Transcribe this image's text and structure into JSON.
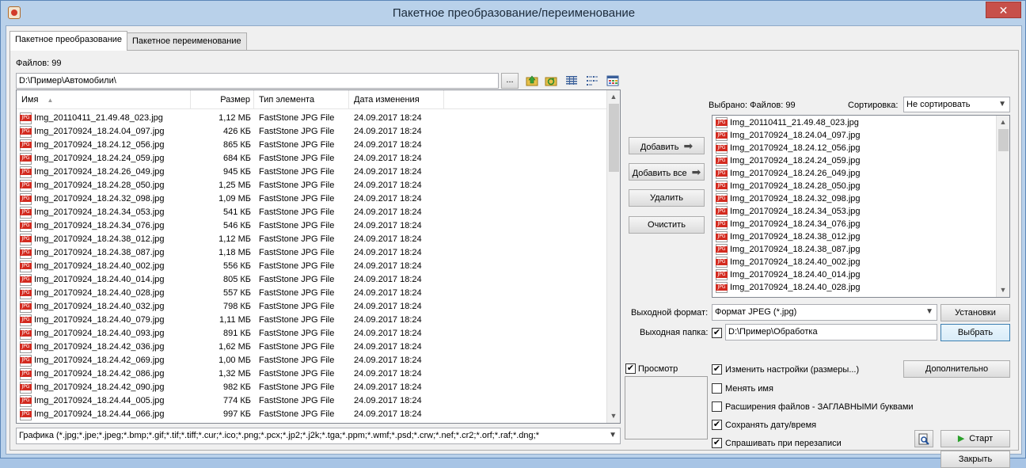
{
  "window": {
    "title": "Пакетное преобразование/переименование",
    "close_glyph": "✕"
  },
  "tabs": [
    {
      "label": "Пакетное преобразование",
      "active": true
    },
    {
      "label": "Пакетное переименование",
      "active": false
    }
  ],
  "source": {
    "files_count_label": "Файлов: 99",
    "path_value": "D:\\Пример\\Автомобили\\",
    "browse_label": "...",
    "toolbar_icons": [
      "folder-up-icon",
      "refresh-folder-icon",
      "details-view-icon",
      "list-view-icon",
      "thumbnails-view-icon"
    ]
  },
  "file_list": {
    "columns": {
      "name": "Имя",
      "size": "Размер",
      "type": "Тип элемента",
      "date": "Дата изменения"
    },
    "sort_glyph": "▲",
    "rows": [
      {
        "name": "Img_20110411_21.49.48_023.jpg",
        "size": "1,12 МБ",
        "type": "FastStone JPG File",
        "date": "24.09.2017 18:24"
      },
      {
        "name": "Img_20170924_18.24.04_097.jpg",
        "size": "426 КБ",
        "type": "FastStone JPG File",
        "date": "24.09.2017 18:24"
      },
      {
        "name": "Img_20170924_18.24.12_056.jpg",
        "size": "865 КБ",
        "type": "FastStone JPG File",
        "date": "24.09.2017 18:24"
      },
      {
        "name": "Img_20170924_18.24.24_059.jpg",
        "size": "684 КБ",
        "type": "FastStone JPG File",
        "date": "24.09.2017 18:24"
      },
      {
        "name": "Img_20170924_18.24.26_049.jpg",
        "size": "945 КБ",
        "type": "FastStone JPG File",
        "date": "24.09.2017 18:24"
      },
      {
        "name": "Img_20170924_18.24.28_050.jpg",
        "size": "1,25 МБ",
        "type": "FastStone JPG File",
        "date": "24.09.2017 18:24"
      },
      {
        "name": "Img_20170924_18.24.32_098.jpg",
        "size": "1,09 МБ",
        "type": "FastStone JPG File",
        "date": "24.09.2017 18:24"
      },
      {
        "name": "Img_20170924_18.24.34_053.jpg",
        "size": "541 КБ",
        "type": "FastStone JPG File",
        "date": "24.09.2017 18:24"
      },
      {
        "name": "Img_20170924_18.24.34_076.jpg",
        "size": "546 КБ",
        "type": "FastStone JPG File",
        "date": "24.09.2017 18:24"
      },
      {
        "name": "Img_20170924_18.24.38_012.jpg",
        "size": "1,12 МБ",
        "type": "FastStone JPG File",
        "date": "24.09.2017 18:24"
      },
      {
        "name": "Img_20170924_18.24.38_087.jpg",
        "size": "1,18 МБ",
        "type": "FastStone JPG File",
        "date": "24.09.2017 18:24"
      },
      {
        "name": "Img_20170924_18.24.40_002.jpg",
        "size": "556 КБ",
        "type": "FastStone JPG File",
        "date": "24.09.2017 18:24"
      },
      {
        "name": "Img_20170924_18.24.40_014.jpg",
        "size": "805 КБ",
        "type": "FastStone JPG File",
        "date": "24.09.2017 18:24"
      },
      {
        "name": "Img_20170924_18.24.40_028.jpg",
        "size": "557 КБ",
        "type": "FastStone JPG File",
        "date": "24.09.2017 18:24"
      },
      {
        "name": "Img_20170924_18.24.40_032.jpg",
        "size": "798 КБ",
        "type": "FastStone JPG File",
        "date": "24.09.2017 18:24"
      },
      {
        "name": "Img_20170924_18.24.40_079.jpg",
        "size": "1,11 МБ",
        "type": "FastStone JPG File",
        "date": "24.09.2017 18:24"
      },
      {
        "name": "Img_20170924_18.24.40_093.jpg",
        "size": "891 КБ",
        "type": "FastStone JPG File",
        "date": "24.09.2017 18:24"
      },
      {
        "name": "Img_20170924_18.24.42_036.jpg",
        "size": "1,62 МБ",
        "type": "FastStone JPG File",
        "date": "24.09.2017 18:24"
      },
      {
        "name": "Img_20170924_18.24.42_069.jpg",
        "size": "1,00 МБ",
        "type": "FastStone JPG File",
        "date": "24.09.2017 18:24"
      },
      {
        "name": "Img_20170924_18.24.42_086.jpg",
        "size": "1,32 МБ",
        "type": "FastStone JPG File",
        "date": "24.09.2017 18:24"
      },
      {
        "name": "Img_20170924_18.24.42_090.jpg",
        "size": "982 КБ",
        "type": "FastStone JPG File",
        "date": "24.09.2017 18:24"
      },
      {
        "name": "Img_20170924_18.24.44_005.jpg",
        "size": "774 КБ",
        "type": "FastStone JPG File",
        "date": "24.09.2017 18:24"
      },
      {
        "name": "Img_20170924_18.24.44_066.jpg",
        "size": "997 КБ",
        "type": "FastStone JPG File",
        "date": "24.09.2017 18:24"
      }
    ]
  },
  "filter": {
    "value": "Графика (*.jpg;*.jpe;*.jpeg;*.bmp;*.gif;*.tif;*.tiff;*.cur;*.ico;*.png;*.pcx;*.jp2;*.j2k;*.tga;*.ppm;*.wmf;*.psd;*.crw;*.nef;*.cr2;*.orf;*.raf;*.dng;*"
  },
  "actions": {
    "add": "Добавить",
    "add_all": "Добавить все",
    "remove": "Удалить",
    "clear": "Очистить",
    "arrow_glyph": "➡"
  },
  "selected": {
    "summary": "Выбрано: Файлов: 99",
    "sort_label": "Сортировка:",
    "sort_value": "Не сортировать",
    "items": [
      "Img_20110411_21.49.48_023.jpg",
      "Img_20170924_18.24.04_097.jpg",
      "Img_20170924_18.24.12_056.jpg",
      "Img_20170924_18.24.24_059.jpg",
      "Img_20170924_18.24.26_049.jpg",
      "Img_20170924_18.24.28_050.jpg",
      "Img_20170924_18.24.32_098.jpg",
      "Img_20170924_18.24.34_053.jpg",
      "Img_20170924_18.24.34_076.jpg",
      "Img_20170924_18.24.38_012.jpg",
      "Img_20170924_18.24.38_087.jpg",
      "Img_20170924_18.24.40_002.jpg",
      "Img_20170924_18.24.40_014.jpg",
      "Img_20170924_18.24.40_028.jpg"
    ]
  },
  "output": {
    "format_label": "Выходной формат:",
    "format_value": "Формат JPEG (*.jpg)",
    "settings_button": "Установки",
    "folder_label": "Выходная папка:",
    "folder_checked": true,
    "folder_value": "D:\\Пример\\Обработка",
    "choose_button": "Выбрать"
  },
  "options": {
    "preview": {
      "label": "Просмотр",
      "checked": true
    },
    "change_settings": {
      "label": "Изменить настройки (размеры...)",
      "checked": true
    },
    "rename": {
      "label": "Менять имя",
      "checked": false
    },
    "uppercase_ext": {
      "label": "Расширения файлов - ЗАГЛАВНЫМИ буквами",
      "checked": false
    },
    "keep_date": {
      "label": "Сохранять дату/время",
      "checked": true
    },
    "ask_overwrite": {
      "label": "Спрашивать при перезаписи",
      "checked": true
    },
    "advanced_button": "Дополнительно"
  },
  "footer": {
    "start_button": "Старт",
    "close_button": "Закрыть",
    "check_glyph": "✔"
  }
}
